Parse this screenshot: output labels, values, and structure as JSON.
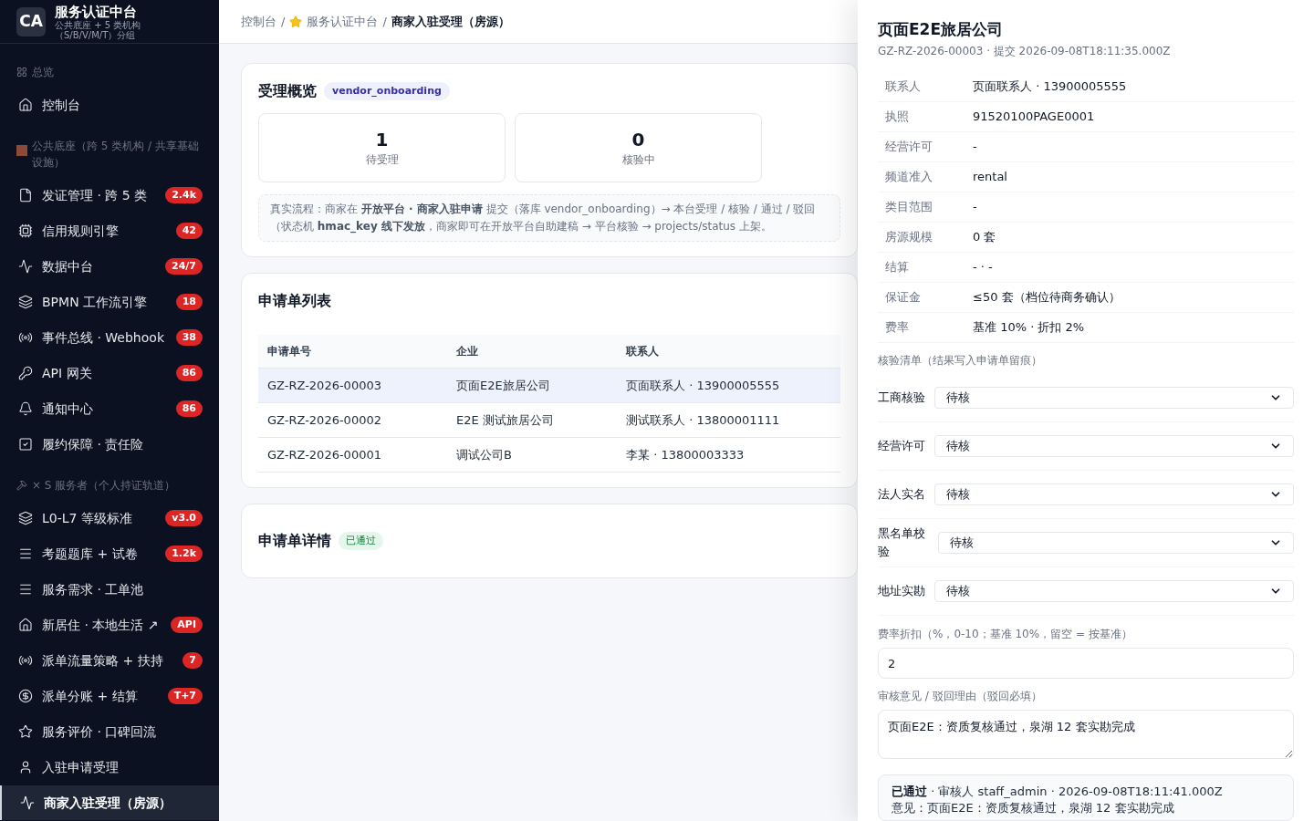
{
  "sidebar": {
    "logo": "CA",
    "title": "服务认证中台",
    "subtitle": "公共底座 + 5 类机构（S/B/V/M/T）分组",
    "groups": [
      {
        "label": "总览",
        "items": [
          {
            "label": "控制台",
            "selected": false
          }
        ]
      },
      {
        "label": "公共底座（跨 5 类机构 / 共享基础设施）",
        "items": [
          {
            "label": "发证管理 · 跨 5 类",
            "badge": "2.4k",
            "selected": false
          },
          {
            "label": "信用规则引擎",
            "badge": "42",
            "selected": false
          },
          {
            "label": "数据中台",
            "badge": "24/7",
            "selected": false
          },
          {
            "label": "BPMN 工作流引擎",
            "badge": "18",
            "selected": false
          },
          {
            "label": "事件总线 · Webhook",
            "badge": "38",
            "selected": false
          },
          {
            "label": "API 网关",
            "badge": "86",
            "selected": false
          },
          {
            "label": "通知中心",
            "badge": "86",
            "selected": false
          },
          {
            "label": "履约保障 · 责任险",
            "selected": false
          }
        ]
      },
      {
        "label": "× S 服务者（个人持证轨道）",
        "items": [
          {
            "label": "L0-L7 等级标准",
            "badge": "v3.0",
            "selected": false
          },
          {
            "label": "考题题库 + 试卷",
            "badge": "1.2k",
            "selected": false
          },
          {
            "label": "服务需求 · 工单池",
            "selected": false
          },
          {
            "label": "新居住 · 本地生活 ↗",
            "badge": "API",
            "selected": false
          },
          {
            "label": "派单流量策略 + 扶持",
            "badge": "7",
            "selected": false
          },
          {
            "label": "派单分账 + 结算",
            "badge": "T+7",
            "selected": false
          },
          {
            "label": "服务评价 · 口碑回流",
            "selected": false
          },
          {
            "label": "入驻申请受理",
            "selected": false
          },
          {
            "label": "商家入驻受理（房源）",
            "selected": true
          }
        ]
      }
    ]
  },
  "breadcrumb": {
    "items": [
      "控制台",
      "服务认证中台"
    ],
    "separator": "/",
    "current": "商家入驻受理（房源）"
  },
  "overview": {
    "title": "受理概览",
    "tag": "vendor_onboarding",
    "stats": [
      {
        "value": "1",
        "label": "待受理"
      },
      {
        "value": "0",
        "label": "核验中"
      }
    ],
    "note": "真实流程：商家在 **开放平台 · 商家入驻申请** 提交（落库 vendor_onboarding）→ 本台受理 / 核验 / 通过 / 驳回（状态机 **hmac_key 线下发放**，商家即可在开放平台自助建稿 → 平台核验 → projects/status 上架。"
  },
  "list": {
    "title": "申请单列表",
    "columns": [
      "申请单号",
      "企业",
      "联系人"
    ],
    "rows": [
      {
        "cells": [
          "GZ-RZ-2026-00003",
          "页面E2E旅居公司",
          "页面联系人 · 13900005555"
        ],
        "selected": true
      },
      {
        "cells": [
          "GZ-RZ-2026-00002",
          "E2E 测试旅居公司",
          "测试联系人 · 13800001111"
        ],
        "selected": false
      },
      {
        "cells": [
          "GZ-RZ-2026-00001",
          "调试公司B",
          "李某 · 13800003333"
        ],
        "selected": false
      }
    ]
  },
  "detail": {
    "title": "申请单详情",
    "status": "已通过"
  },
  "drawer": {
    "title": "页面E2E旅居公司",
    "subtitle": "GZ-RZ-2026-00003 · 提交 2026-09-08T18:11:35.000Z",
    "fields": [
      {
        "label": "联系人",
        "value": "页面联系人 · 13900005555"
      },
      {
        "label": "执照",
        "value": "91520100PAGE0001"
      },
      {
        "label": "经营许可",
        "value": "-"
      },
      {
        "label": "频道准入",
        "value": "rental"
      },
      {
        "label": "类目范围",
        "value": "-"
      },
      {
        "label": "房源规模",
        "value": "0 套"
      },
      {
        "label": "结算",
        "value": "- · -"
      },
      {
        "label": "保证金",
        "value": "≤50 套（档位待商务确认）"
      },
      {
        "label": "费率",
        "value": "基准 10% · 折扣 2%"
      }
    ],
    "checklist_label": "核验清单（结果写入申请单留痕）",
    "checks": [
      {
        "label": "工商核验",
        "value": "待核"
      },
      {
        "label": "经营许可",
        "value": "待核"
      },
      {
        "label": "法人实名",
        "value": "待核"
      },
      {
        "label": "黑名单校验",
        "value": "待核"
      },
      {
        "label": "地址实勘",
        "value": "待核"
      }
    ],
    "discount": {
      "label": "费率折扣（%，0-10；基准 10%，留空 = 按基准）",
      "value": "2"
    },
    "comment": {
      "label": "审核意见 / 驳回理由（驳回必填）",
      "value": "页面E2E：资质复核通过，泉湖 12 套实勘完成"
    },
    "result": [
      "**已通过** · 审核人 staff_admin · 2026-09-08T18:11:41.000Z",
      "意见：页面E2E：资质复核通过，泉湖 12 套实勘完成"
    ]
  }
}
